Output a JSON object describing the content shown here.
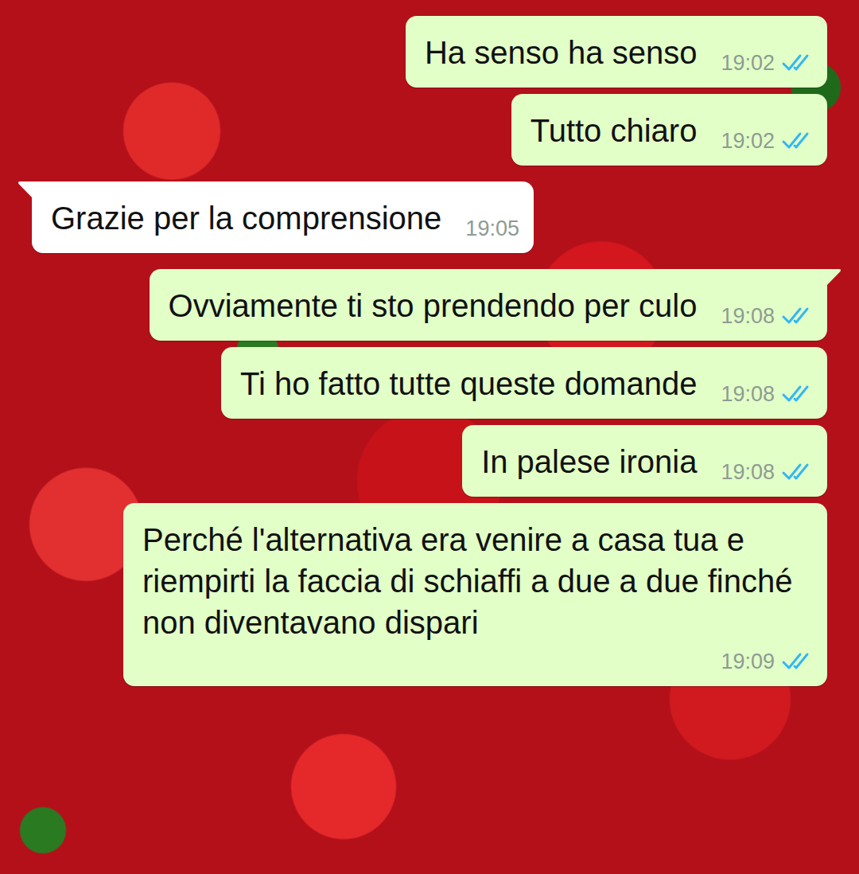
{
  "messages": [
    {
      "kind": "outgoing",
      "tail": false,
      "text": "Ha senso ha senso",
      "time": "19:02",
      "read": true
    },
    {
      "kind": "outgoing",
      "tail": false,
      "text": "Tutto chiaro",
      "time": "19:02",
      "read": true
    },
    {
      "kind": "incoming",
      "tail": true,
      "text": "Grazie per la comprensione",
      "time": "19:05"
    },
    {
      "kind": "outgoing",
      "tail": true,
      "text": "Ovviamente ti sto prendendo per culo",
      "time": "19:08",
      "read": true
    },
    {
      "kind": "outgoing",
      "tail": false,
      "text": "Ti ho fatto tutte queste domande",
      "time": "19:08",
      "read": true
    },
    {
      "kind": "outgoing",
      "tail": false,
      "text": "In palese ironia",
      "time": "19:08",
      "read": true
    },
    {
      "kind": "outgoing",
      "tail": false,
      "text": "Perché l'alternativa era venire a casa tua e riempirti la faccia di schiaffi a due a due finché non diventavano dispari",
      "time": "19:09",
      "read": true
    }
  ]
}
